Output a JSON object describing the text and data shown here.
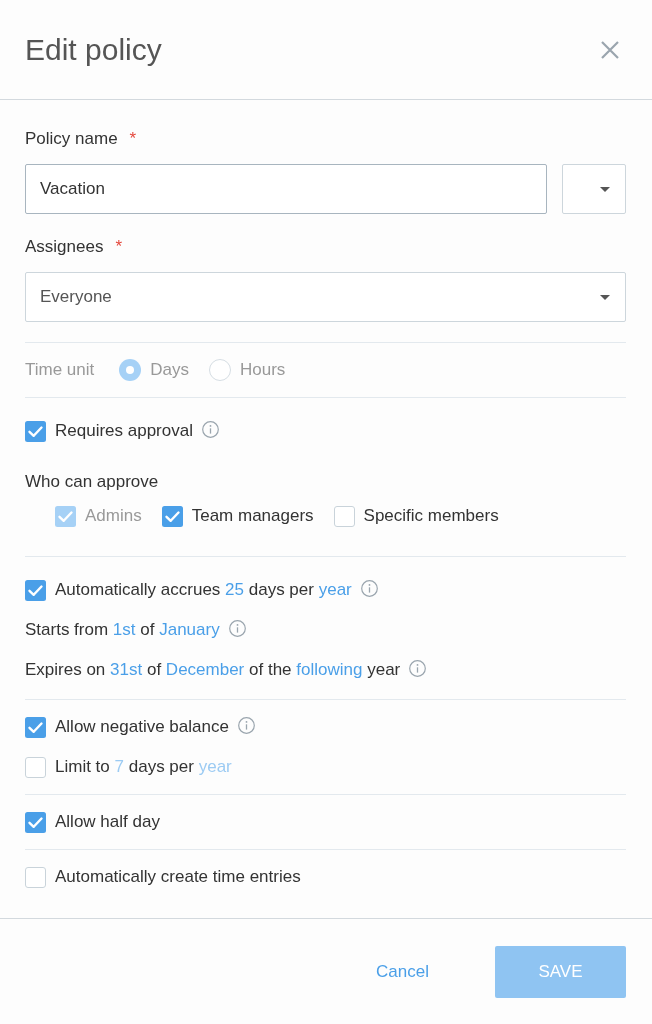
{
  "dialog": {
    "title": "Edit policy"
  },
  "policy_name": {
    "label": "Policy name",
    "required_mark": "*",
    "value": "Vacation"
  },
  "assignees": {
    "label": "Assignees",
    "required_mark": "*",
    "value": "Everyone"
  },
  "time_unit": {
    "label": "Time unit",
    "disabled": true,
    "options": [
      {
        "label": "Days",
        "selected": true
      },
      {
        "label": "Hours",
        "selected": false
      }
    ]
  },
  "sections": [
    {
      "rows": [
        {
          "kind": "checkbox",
          "checked": true,
          "info": true,
          "parts": [
            {
              "text": "Requires approval",
              "link": false
            }
          ]
        }
      ],
      "approvers": {
        "label": "Who can approve",
        "options": [
          {
            "label": "Admins",
            "checked": true,
            "disabled": true
          },
          {
            "label": "Team managers",
            "checked": true,
            "disabled": false
          },
          {
            "label": "Specific members",
            "checked": false,
            "disabled": false
          }
        ]
      }
    },
    {
      "rows": [
        {
          "kind": "checkbox",
          "checked": true,
          "info": true,
          "parts": [
            {
              "text": "Automatically accrues",
              "link": false
            },
            {
              "text": "25",
              "link": true
            },
            {
              "text": "days per",
              "link": false
            },
            {
              "text": "year",
              "link": true
            }
          ]
        },
        {
          "kind": "text",
          "info": true,
          "parts": [
            {
              "text": "Starts from",
              "link": false
            },
            {
              "text": "1st",
              "link": true
            },
            {
              "text": "of",
              "link": false
            },
            {
              "text": "January",
              "link": true
            }
          ]
        },
        {
          "kind": "text",
          "info": true,
          "parts": [
            {
              "text": "Expires on",
              "link": false
            },
            {
              "text": "31st",
              "link": true
            },
            {
              "text": "of",
              "link": false
            },
            {
              "text": "December",
              "link": true
            },
            {
              "text": "of the",
              "link": false
            },
            {
              "text": "following",
              "link": true
            },
            {
              "text": "year",
              "link": false
            }
          ]
        }
      ]
    },
    {
      "rows": [
        {
          "kind": "checkbox",
          "checked": true,
          "info": true,
          "parts": [
            {
              "text": "Allow negative balance",
              "link": false
            }
          ]
        },
        {
          "kind": "checkbox",
          "checked": false,
          "info": false,
          "parts": [
            {
              "text": "Limit to",
              "link": false
            },
            {
              "text": "7",
              "link": true
            },
            {
              "text": "days per",
              "link": false
            },
            {
              "text": "year",
              "link": true
            }
          ]
        }
      ]
    },
    {
      "rows": [
        {
          "kind": "checkbox",
          "checked": true,
          "info": false,
          "parts": [
            {
              "text": "Allow half day",
              "link": false
            }
          ]
        }
      ]
    },
    {
      "rows": [
        {
          "kind": "checkbox",
          "checked": false,
          "info": false,
          "parts": [
            {
              "text": "Automatically create time entries",
              "link": false
            }
          ]
        }
      ]
    }
  ],
  "footer": {
    "buttons": [
      {
        "label": "Cancel",
        "kind": "text",
        "disabled": false
      },
      {
        "label": "SAVE",
        "kind": "primary",
        "disabled": true
      }
    ]
  }
}
